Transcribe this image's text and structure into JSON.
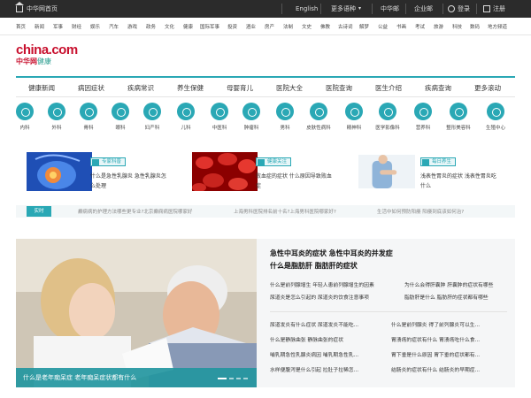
{
  "topbar": {
    "home_label": "中华网首页",
    "lang": "English",
    "more_lang": "更多语种",
    "mail": "中华邮",
    "corp_mail": "企业邮",
    "login": "登录",
    "register": "注册"
  },
  "channels": [
    "首页",
    "新闻",
    "军事",
    "财经",
    "娱乐",
    "汽车",
    "游戏",
    "政务",
    "文化",
    "健康",
    "国际军事",
    "投资",
    "酒业",
    "房产",
    "法制",
    "文史",
    "佛教",
    "古诗词",
    "解梦",
    "公益",
    "书画",
    "考试",
    "旅游",
    "科技",
    "数码",
    "地方频道"
  ],
  "logo": {
    "top": "china.com",
    "cn": "中华网",
    "suffix": "健康"
  },
  "main_nav": [
    "健康新闻",
    "病因症状",
    "疾病常识",
    "养生保健",
    "母婴育儿",
    "医院大全",
    "医院查询",
    "医生介绍",
    "疾病查询",
    "更多滚动"
  ],
  "categories": [
    "内科",
    "外科",
    "骨科",
    "眼科",
    "妇产科",
    "儿科",
    "中医科",
    "肿瘤科",
    "男科",
    "皮肤性病科",
    "精神科",
    "医学影像科",
    "营养科",
    "整形美容科",
    "生殖中心"
  ],
  "features": [
    {
      "tag": "专家科普",
      "lines": [
        "什么是急性乳腺炎 急性乳腺炎怎",
        "么处理"
      ]
    },
    {
      "tag": "健康关注",
      "lines": [
        "败血症的症状 什么原因导致败血",
        "症"
      ]
    },
    {
      "tag": "每日养生",
      "lines": [
        "浅表性胃炎的症状 浅表性胃炎吃",
        "什么"
      ]
    }
  ],
  "ticker": {
    "label": "实时",
    "items": [
      "癫痫病的护理方法哪些更专业?北京癫痫病医院哪家好",
      "上海男科医院排名前十名?上海男科医院哪家好?",
      "生活中如何预防阳痿 阳痿到底该如何治?"
    ]
  },
  "carousel": {
    "caption": "什么是老年痴呆症 老年痴呆症状都有什么"
  },
  "headlines": [
    "急性中耳炎的症状 急性中耳炎的并发症",
    "什么是脂肪肝 脂肪肝的症状"
  ],
  "link_rows_a": [
    [
      "什么是前列腺增生 年轻人患前列腺增生的因素",
      "为什么会得肝囊肿 肝囊肿的症状有哪些"
    ],
    [
      "尿道炎是怎么引起的 尿道炎的饮食注意事项",
      "脂肪肝是什么 脂肪肝的症状都有哪些"
    ]
  ],
  "link_rows_b": [
    [
      "尿道发炎有什么症状 尿道发炎不能吃...",
      "什么是前列腺炎 得了前列腺炎可以生..."
    ],
    [
      "什么是静脉曲张 静脉曲张的症状",
      "胃溃疡的症状有什么 胃溃疡吃什么食..."
    ],
    [
      "哺乳期急性乳腺炎病因 哺乳期急性乳...",
      "胃下垂是什么原因 胃下垂的症状都有..."
    ],
    [
      "水样便腹泻是什么引起 拉肚子拉稀怎...",
      "结肠炎的症状有什么 结肠炎的早期症..."
    ]
  ]
}
